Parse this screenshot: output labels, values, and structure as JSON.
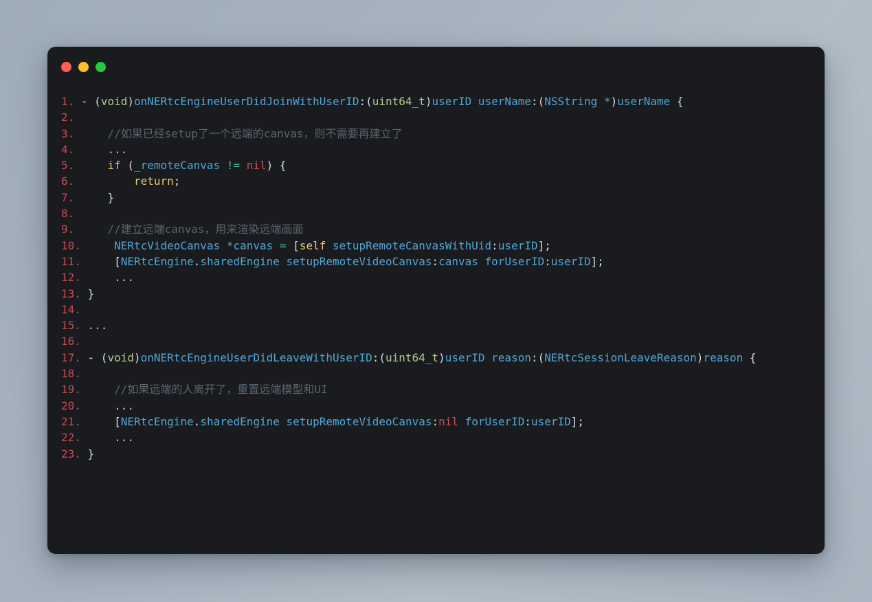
{
  "window": {
    "background_color": "#1A1B1E",
    "desktop_background_color": "#A8B4C0",
    "controls": [
      {
        "name": "close",
        "color": "#FF5F56"
      },
      {
        "name": "minimize",
        "color": "#FFBD2E"
      },
      {
        "name": "maximize",
        "color": "#27C93F"
      }
    ]
  },
  "code": {
    "language": "objective-c",
    "theme_colors": {
      "line_number": "#C94A54",
      "plain": "#D7DBDF",
      "type": "#B5CC8E",
      "identifier": "#4FA6D8",
      "keyword": "#E6C878",
      "operator": "#3FBF8F",
      "constant": "#D04A52",
      "comment": "#5A6570"
    },
    "lines": [
      {
        "n": "1.",
        "tokens": [
          {
            "t": "plain",
            "v": "- "
          },
          {
            "t": "plain",
            "v": "("
          },
          {
            "t": "type",
            "v": "void"
          },
          {
            "t": "plain",
            "v": ")"
          },
          {
            "t": "ident",
            "v": "onNERtcEngineUserDidJoinWithUserID"
          },
          {
            "t": "plain",
            "v": ":("
          },
          {
            "t": "type",
            "v": "uint64_t"
          },
          {
            "t": "plain",
            "v": ")"
          },
          {
            "t": "ident",
            "v": "userID userName"
          },
          {
            "t": "plain",
            "v": ":("
          },
          {
            "t": "ident",
            "v": "NSString "
          },
          {
            "t": "op",
            "v": "*"
          },
          {
            "t": "plain",
            "v": ")"
          },
          {
            "t": "ident",
            "v": "userName"
          },
          {
            "t": "plain",
            "v": " {"
          }
        ]
      },
      {
        "n": "2.",
        "tokens": []
      },
      {
        "n": "3.",
        "tokens": [
          {
            "t": "comment",
            "v": "    //如果已经setup了一个远端的canvas，则不需要再建立了"
          }
        ]
      },
      {
        "n": "4.",
        "tokens": [
          {
            "t": "dots",
            "v": "    ..."
          }
        ]
      },
      {
        "n": "5.",
        "tokens": [
          {
            "t": "kw",
            "v": "    if"
          },
          {
            "t": "plain",
            "v": " ("
          },
          {
            "t": "ident",
            "v": "_remoteCanvas"
          },
          {
            "t": "plain",
            "v": " "
          },
          {
            "t": "op",
            "v": "!="
          },
          {
            "t": "plain",
            "v": " "
          },
          {
            "t": "const",
            "v": "nil"
          },
          {
            "t": "plain",
            "v": ") {"
          }
        ]
      },
      {
        "n": "6.",
        "tokens": [
          {
            "t": "kw",
            "v": "        return"
          },
          {
            "t": "plain",
            "v": ";"
          }
        ]
      },
      {
        "n": "7.",
        "tokens": [
          {
            "t": "plain",
            "v": "    }"
          }
        ]
      },
      {
        "n": "8.",
        "tokens": []
      },
      {
        "n": "9.",
        "tokens": [
          {
            "t": "comment",
            "v": "    //建立远端canvas，用来渲染远端画面"
          }
        ]
      },
      {
        "n": "10.",
        "tokens": [
          {
            "t": "ident",
            "v": "    NERtcVideoCanvas "
          },
          {
            "t": "op",
            "v": "*"
          },
          {
            "t": "ident",
            "v": "canvas"
          },
          {
            "t": "plain",
            "v": " "
          },
          {
            "t": "op",
            "v": "="
          },
          {
            "t": "plain",
            "v": " ["
          },
          {
            "t": "kw",
            "v": "self"
          },
          {
            "t": "plain",
            "v": " "
          },
          {
            "t": "ident",
            "v": "setupRemoteCanvasWithUid"
          },
          {
            "t": "plain",
            "v": ":"
          },
          {
            "t": "ident",
            "v": "userID"
          },
          {
            "t": "plain",
            "v": "];"
          }
        ]
      },
      {
        "n": "11.",
        "tokens": [
          {
            "t": "plain",
            "v": "    ["
          },
          {
            "t": "ident",
            "v": "NERtcEngine"
          },
          {
            "t": "plain",
            "v": "."
          },
          {
            "t": "ident",
            "v": "sharedEngine"
          },
          {
            "t": "plain",
            "v": " "
          },
          {
            "t": "ident",
            "v": "setupRemoteVideoCanvas"
          },
          {
            "t": "plain",
            "v": ":"
          },
          {
            "t": "ident",
            "v": "canvas forUserID"
          },
          {
            "t": "plain",
            "v": ":"
          },
          {
            "t": "ident",
            "v": "userID"
          },
          {
            "t": "plain",
            "v": "];"
          }
        ]
      },
      {
        "n": "12.",
        "tokens": [
          {
            "t": "dots",
            "v": "    ..."
          }
        ]
      },
      {
        "n": "13.",
        "tokens": [
          {
            "t": "plain",
            "v": "}"
          }
        ]
      },
      {
        "n": "14.",
        "tokens": []
      },
      {
        "n": "15.",
        "tokens": [
          {
            "t": "dots",
            "v": "..."
          }
        ]
      },
      {
        "n": "16.",
        "tokens": []
      },
      {
        "n": "17.",
        "tokens": [
          {
            "t": "plain",
            "v": "- "
          },
          {
            "t": "plain",
            "v": "("
          },
          {
            "t": "type",
            "v": "void"
          },
          {
            "t": "plain",
            "v": ")"
          },
          {
            "t": "ident",
            "v": "onNERtcEngineUserDidLeaveWithUserID"
          },
          {
            "t": "plain",
            "v": ":("
          },
          {
            "t": "type",
            "v": "uint64_t"
          },
          {
            "t": "plain",
            "v": ")"
          },
          {
            "t": "ident",
            "v": "userID reason"
          },
          {
            "t": "plain",
            "v": ":("
          },
          {
            "t": "ident",
            "v": "NERtcSessionLeaveReason"
          },
          {
            "t": "plain",
            "v": ")"
          },
          {
            "t": "ident",
            "v": "reason"
          },
          {
            "t": "plain",
            "v": " {"
          }
        ]
      },
      {
        "n": "18.",
        "tokens": []
      },
      {
        "n": "19.",
        "tokens": [
          {
            "t": "comment",
            "v": "    //如果远端的人离开了，重置远端模型和UI"
          }
        ]
      },
      {
        "n": "20.",
        "tokens": [
          {
            "t": "dots",
            "v": "    ..."
          }
        ]
      },
      {
        "n": "21.",
        "tokens": [
          {
            "t": "plain",
            "v": "    ["
          },
          {
            "t": "ident",
            "v": "NERtcEngine"
          },
          {
            "t": "plain",
            "v": "."
          },
          {
            "t": "ident",
            "v": "sharedEngine"
          },
          {
            "t": "plain",
            "v": " "
          },
          {
            "t": "ident",
            "v": "setupRemoteVideoCanvas"
          },
          {
            "t": "plain",
            "v": ":"
          },
          {
            "t": "const",
            "v": "nil"
          },
          {
            "t": "plain",
            "v": " "
          },
          {
            "t": "ident",
            "v": "forUserID"
          },
          {
            "t": "plain",
            "v": ":"
          },
          {
            "t": "ident",
            "v": "userID"
          },
          {
            "t": "plain",
            "v": "];"
          }
        ]
      },
      {
        "n": "22.",
        "tokens": [
          {
            "t": "dots",
            "v": "    ..."
          }
        ]
      },
      {
        "n": "23.",
        "tokens": [
          {
            "t": "plain",
            "v": "}"
          }
        ]
      }
    ]
  }
}
